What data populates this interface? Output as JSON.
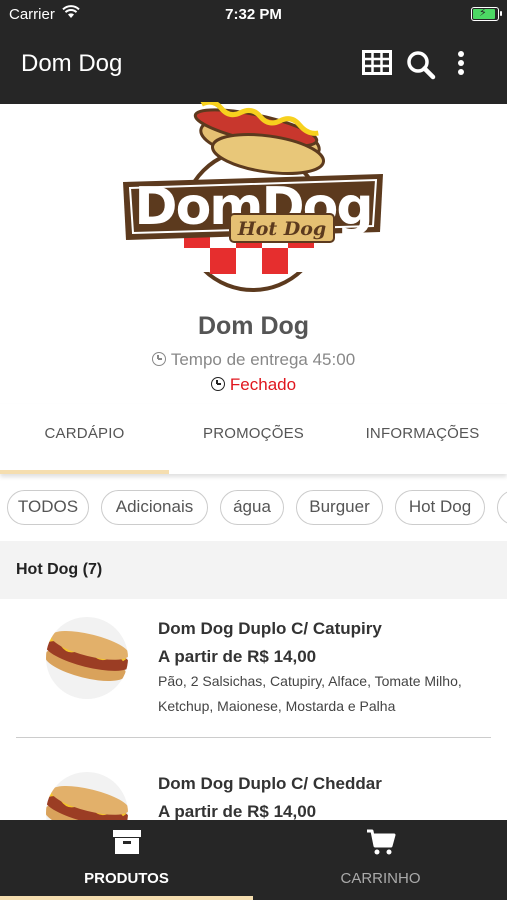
{
  "status_bar": {
    "carrier": "Carrier",
    "time": "7:32 PM"
  },
  "app_bar": {
    "title": "Dom Dog",
    "icons": [
      "grid-icon",
      "search-icon",
      "more-vertical-icon"
    ]
  },
  "store": {
    "logo_text": "DomDog",
    "logo_subtext": "Hot Dog",
    "name": "Dom Dog",
    "delivery_time": "Tempo de entrega 45:00",
    "status": "Fechado"
  },
  "tabs": [
    {
      "label": "CARDÁPIO",
      "active": true
    },
    {
      "label": "PROMOÇÕES",
      "active": false
    },
    {
      "label": "INFORMAÇÕES",
      "active": false
    }
  ],
  "categories": [
    "TODOS",
    "Adicionais",
    "água",
    "Burguer",
    "Hot Dog"
  ],
  "section": {
    "title": "Hot Dog (7)"
  },
  "products": [
    {
      "name": "Dom Dog Duplo C/ Catupiry",
      "price": "A partir de R$ 14,00",
      "description": "Pão, 2 Salsichas, Catupiry, Alface, Tomate Milho, Ketchup, Maionese, Mostarda e Palha"
    },
    {
      "name": "Dom Dog Duplo C/ Cheddar",
      "price": "A partir de R$ 14,00"
    }
  ],
  "bottom_nav": [
    {
      "label": "PRODUTOS",
      "active": true
    },
    {
      "label": "CARRINHO",
      "active": false
    }
  ],
  "colors": {
    "bar": "#262626",
    "accent": "#f5deb0",
    "closed": "#e0161e",
    "logo_brown": "#5c3a1e"
  }
}
